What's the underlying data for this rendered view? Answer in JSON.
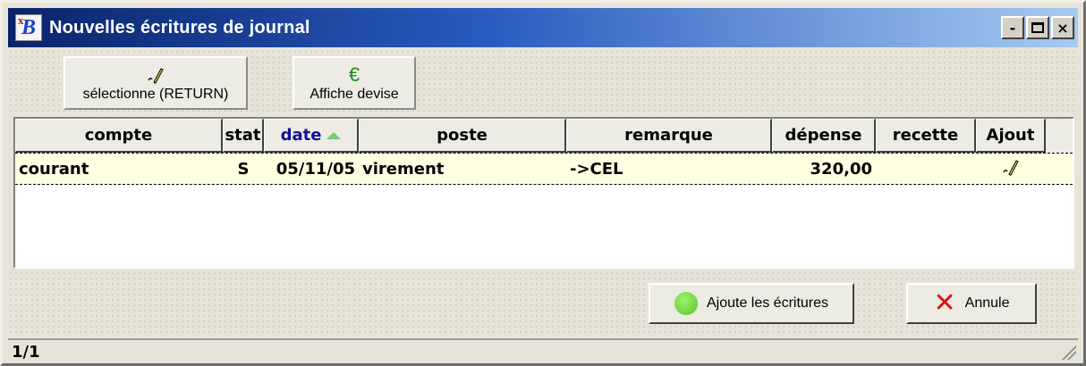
{
  "window": {
    "title": "Nouvelles écritures de journal",
    "icon": "app-xb-icon",
    "minimize": "-",
    "close": "×"
  },
  "toolbar": {
    "select_label": "sélectionne (RETURN)",
    "select_icon": "pencil-icon",
    "devise_label": "Affiche devise",
    "devise_icon_glyph": "€"
  },
  "grid": {
    "columns": [
      "compte",
      "stat",
      "date",
      "poste",
      "remarque",
      "dépense",
      "recette",
      "Ajout"
    ],
    "sorted_column": "date",
    "rows": [
      {
        "compte": "courant",
        "stat": "S",
        "date": "05/11/05",
        "poste": "virement",
        "remarque": "->CEL",
        "depense": "320,00",
        "recette": "",
        "ajout_icon": "pencil-icon"
      }
    ]
  },
  "actions": {
    "ajoute_label": "Ajoute les écritures",
    "annule_label": "Annule"
  },
  "status": {
    "page": "1/1"
  },
  "colors": {
    "title_start": "#0a246a",
    "title_end": "#a6caf0",
    "row_highlight": "#ffffe2",
    "sorted_header": "#10109a",
    "ok_green": "#58c828",
    "cancel_red": "#e01010"
  }
}
